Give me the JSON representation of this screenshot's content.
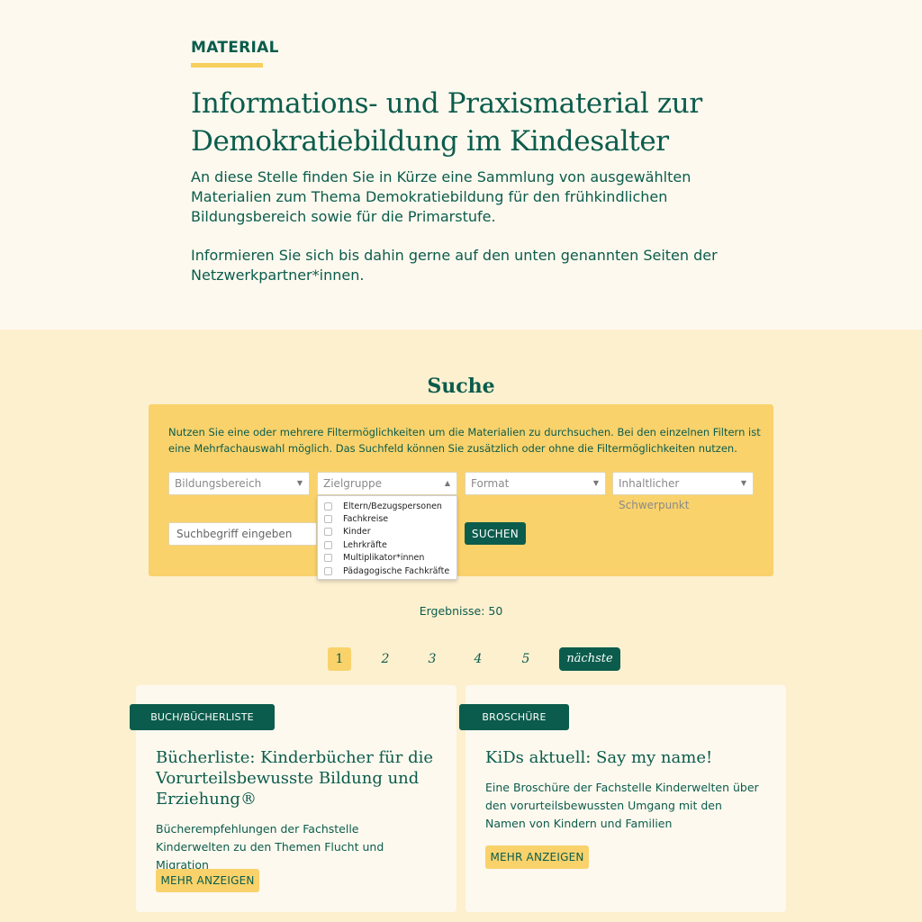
{
  "header": {
    "eyebrow": "MATERIAL",
    "title": "Informations- und Praxismaterial zur Demokratiebildung im Kindesalter",
    "intro_1": "An diese Stelle finden Sie in Kürze eine Sammlung von ausgewählten Materialien zum Thema Demokratiebildung für den frühkindlichen Bildungsbereich sowie für die Primarstufe.",
    "intro_2": "Informieren Sie sich bis dahin gerne auf den unten genannten Seiten der Netzwerkpartner*innen."
  },
  "search": {
    "heading": "Suche",
    "hint": "Nutzen Sie eine oder mehrere Filtermöglichkeiten um die Materialien zu durchsuchen. Bei den einzelnen Filtern ist eine Mehrfachauswahl möglich. Das Suchfeld können Sie zusätzlich oder ohne die Filtermöglichkeiten nutzen.",
    "filters": {
      "bildungsbereich": "Bildungsbereich",
      "zielgruppe": "Zielgruppe",
      "format": "Format",
      "schwerpunkt": "Inhaltlicher Schwerpunkt"
    },
    "zielgruppe_options": [
      "Eltern/Bezugspersonen",
      "Fachkreise",
      "Kinder",
      "Lehrkräfte",
      "Multiplikator*innen",
      "Pädagogische Fachkräfte"
    ],
    "input_placeholder": "Suchbegriff eingeben",
    "submit_label": "SUCHEN"
  },
  "results": {
    "label": "Ergebnisse: 50"
  },
  "pagination": {
    "pages": [
      "1",
      "2",
      "3",
      "4",
      "5"
    ],
    "current": "1",
    "next_label": "nächste"
  },
  "cards": [
    {
      "tag": "BUCH/BÜCHERLISTE",
      "title": "Bücherliste: Kinderbücher für die Vorurteilsbewusste Bildung und Erziehung®",
      "description": "Bücherempfehlungen der Fachstelle Kinderwelten zu den Themen Flucht und Migration",
      "button": "MEHR ANZEIGEN"
    },
    {
      "tag": "BROSCHÜRE",
      "title": "KiDs aktuell: Say my name!",
      "description": "Eine Broschüre der Fachstelle Kinderwelten über den vorurteilsbewussten Umgang mit den Namen von Kindern und Familien",
      "button": "MEHR ANZEIGEN"
    }
  ],
  "colors": {
    "primary": "#0b5c4c",
    "accent": "#f9d26b",
    "section_bg": "#fdf0cf",
    "page_bg": "#fdf9ef"
  }
}
